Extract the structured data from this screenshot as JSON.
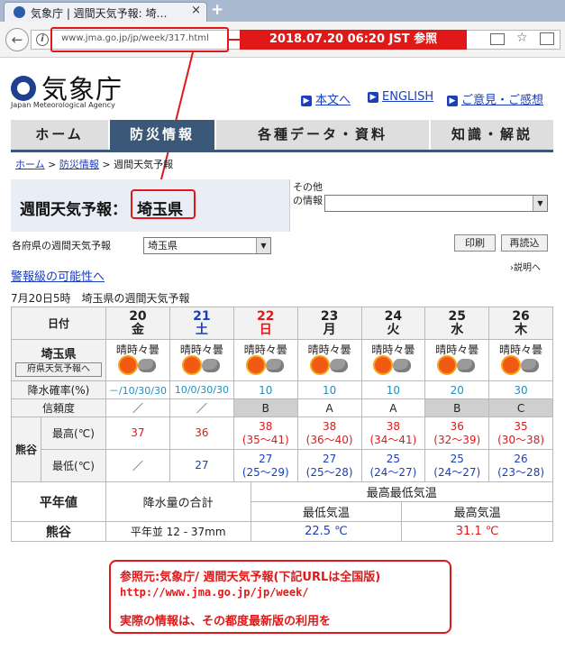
{
  "browser": {
    "tab_title": "気象庁 | 週間天気予報: 埼…",
    "tab_close": "×",
    "new_tab": "+",
    "back": "←",
    "info": "i",
    "url": "www.jma.go.jp/jp/week/317.html",
    "annotation": "2018.07.20 06:20 JST 参照"
  },
  "header": {
    "logo_text": "気象庁",
    "logo_en": "Japan Meteorological Agency",
    "links": [
      "本文へ",
      "ENGLISH",
      "ご意見・ご感想"
    ],
    "link_arrow": "▶"
  },
  "nav": [
    "ホーム",
    "防災情報",
    "各種データ・資料",
    "知識・解説"
  ],
  "breadcrumb": {
    "home": "ホーム",
    "sep": " > ",
    "bousai": "防災情報",
    "current": "週間天気予報"
  },
  "title": {
    "prefix": "週間天気予報：",
    "prefecture": "埼玉県",
    "other_label": "その他の情報",
    "other_value": ""
  },
  "pref_select": {
    "label": "各府県の週間天気予報",
    "value": "埼玉県"
  },
  "buttons": {
    "print": "印刷",
    "reload": "再読込",
    "pref_forecast": "府県天気予報へ"
  },
  "warning_link": "警報級の可能性へ",
  "help_link": "説明へ",
  "issued": "7月20日5時　埼玉県の週間天気予報",
  "table": {
    "date_label": "日付",
    "area": "埼玉県",
    "days": [
      {
        "d": "20",
        "w": "金",
        "type": "wk",
        "wx": "晴時々曇",
        "pop": "－/10/30/30",
        "rel": "／",
        "city_hi": "37",
        "hi_range": "",
        "city_lo": "／",
        "lo_range": ""
      },
      {
        "d": "21",
        "w": "土",
        "type": "sat",
        "wx": "晴時々曇",
        "pop": "10/0/30/30",
        "rel": "／",
        "city_hi": "36",
        "hi_range": "",
        "city_lo": "27",
        "lo_range": ""
      },
      {
        "d": "22",
        "w": "日",
        "type": "sun",
        "wx": "晴時々曇",
        "pop": "10",
        "rel": "B",
        "city_hi": "38",
        "hi_range": "(35～41)",
        "city_lo": "27",
        "lo_range": "(25～29)"
      },
      {
        "d": "23",
        "w": "月",
        "type": "wk",
        "wx": "晴時々曇",
        "pop": "10",
        "rel": "A",
        "city_hi": "38",
        "hi_range": "(36～40)",
        "city_lo": "27",
        "lo_range": "(25～28)"
      },
      {
        "d": "24",
        "w": "火",
        "type": "wk",
        "wx": "晴時々曇",
        "pop": "10",
        "rel": "A",
        "city_hi": "38",
        "hi_range": "(34～41)",
        "city_lo": "25",
        "lo_range": "(24～27)"
      },
      {
        "d": "25",
        "w": "水",
        "type": "wk",
        "wx": "晴時々曇",
        "pop": "20",
        "rel": "B",
        "city_hi": "36",
        "hi_range": "(32～39)",
        "city_lo": "25",
        "lo_range": "(24～27)"
      },
      {
        "d": "26",
        "w": "木",
        "type": "wk",
        "wx": "晴時々曇",
        "pop": "30",
        "rel": "C",
        "city_hi": "35",
        "hi_range": "(30～38)",
        "city_lo": "26",
        "lo_range": "(23～28)"
      }
    ],
    "pop_label": "降水確率(%)",
    "rel_label": "信頼度",
    "city": "熊谷",
    "hi_label": "最高(℃)",
    "lo_label": "最低(℃)"
  },
  "climate": {
    "label": "平年値",
    "precip_head": "降水量の合計",
    "temp_head": "最高最低気温",
    "lo_head": "最低気温",
    "hi_head": "最高気温",
    "city": "熊谷",
    "precip": "平年並 12 - 37mm",
    "lo": "22.5 ℃",
    "hi": "31.1 ℃"
  },
  "notice": {
    "line1": "参照元:気象庁/ 週間天気予報(下記URLは全国版)",
    "line2": "http://www.jma.go.jp/jp/week/",
    "line3": "実際の情報は、その都度最新版の利用を"
  },
  "colors": {
    "accent_red": "#e01818",
    "nav_active": "#3b5878",
    "link": "#1a3fbd",
    "pop": "#1f8fbf"
  }
}
